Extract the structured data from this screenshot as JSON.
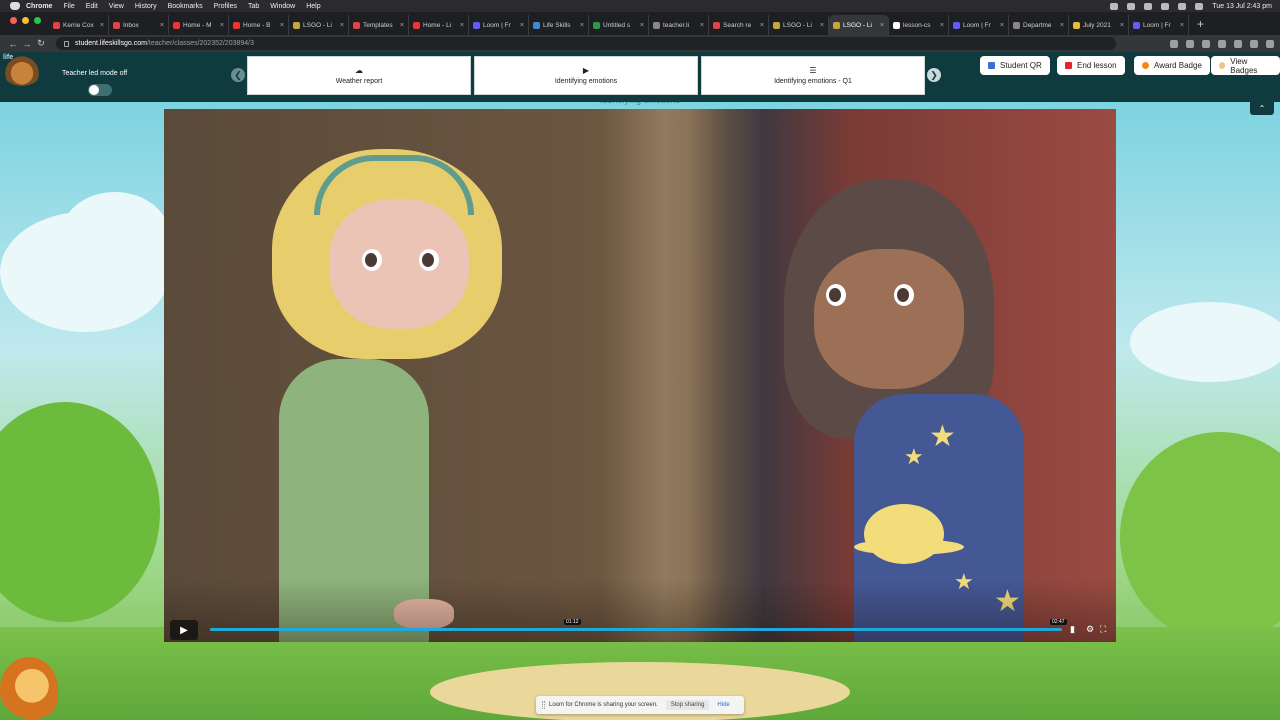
{
  "menubar": {
    "items": [
      "Chrome",
      "File",
      "Edit",
      "View",
      "History",
      "Bookmarks",
      "Profiles",
      "Tab",
      "Window",
      "Help"
    ],
    "clock": "Tue 13 Jul  2:43 pm"
  },
  "tabs": [
    {
      "title": "Kerrie Cox",
      "color": "#d44"
    },
    {
      "title": "Inbox",
      "color": "#d44"
    },
    {
      "title": "Home - M",
      "color": "#e33"
    },
    {
      "title": "Home - B",
      "color": "#e33"
    },
    {
      "title": "LSGO - Li",
      "color": "#c9a43a"
    },
    {
      "title": "Templates",
      "color": "#d44"
    },
    {
      "title": "Home - Li",
      "color": "#e33"
    },
    {
      "title": "Loom | Fr",
      "color": "#625df5"
    },
    {
      "title": "Life Skills",
      "color": "#3a8bd4"
    },
    {
      "title": "Untitled s",
      "color": "#2b9a4a"
    },
    {
      "title": "teacher.li",
      "color": "#888"
    },
    {
      "title": "Search re",
      "color": "#d44"
    },
    {
      "title": "LSGO - Li",
      "color": "#c9a43a"
    },
    {
      "title": "LSGO - Li",
      "color": "#c9a43a",
      "active": true
    },
    {
      "title": "lesson-cs",
      "color": "#fff"
    },
    {
      "title": "Loom | Fr",
      "color": "#625df5"
    },
    {
      "title": "Departme",
      "color": "#888"
    },
    {
      "title": "July 2021",
      "color": "#e6b93a"
    },
    {
      "title": "Loom | Fr",
      "color": "#625df5"
    }
  ],
  "address": {
    "host": "student.lifeskillsgo.com",
    "path": "/teacher/classes/202352/203894/3"
  },
  "app": {
    "logo_text": "life",
    "teacher_led_label": "Teacher led mode off",
    "slides": [
      {
        "label": "Weather report",
        "icon": "☁"
      },
      {
        "label": "Identifying emotions",
        "icon": "▶"
      },
      {
        "label": "Identifying emotions - Q1",
        "icon": "☰"
      }
    ],
    "buttons": {
      "student_qr": "Student QR",
      "end_lesson": "End lesson",
      "award_badge": "Award Badge",
      "view_badges": "View Badges"
    },
    "slide_heading": "Identifying emotions"
  },
  "video": {
    "progress_fraction": 0.999,
    "hover_time": "01:12",
    "duration": "02:47"
  },
  "share_bar": {
    "message": "Loom for Chrome is sharing your screen.",
    "stop_label": "Stop sharing",
    "hide_label": "Hide"
  },
  "colors": {
    "appbar": "#0f3b3f",
    "accent_blue": "#1fa8dc",
    "end_lesson_red": "#e0262b",
    "award_orange": "#f08a1c"
  }
}
